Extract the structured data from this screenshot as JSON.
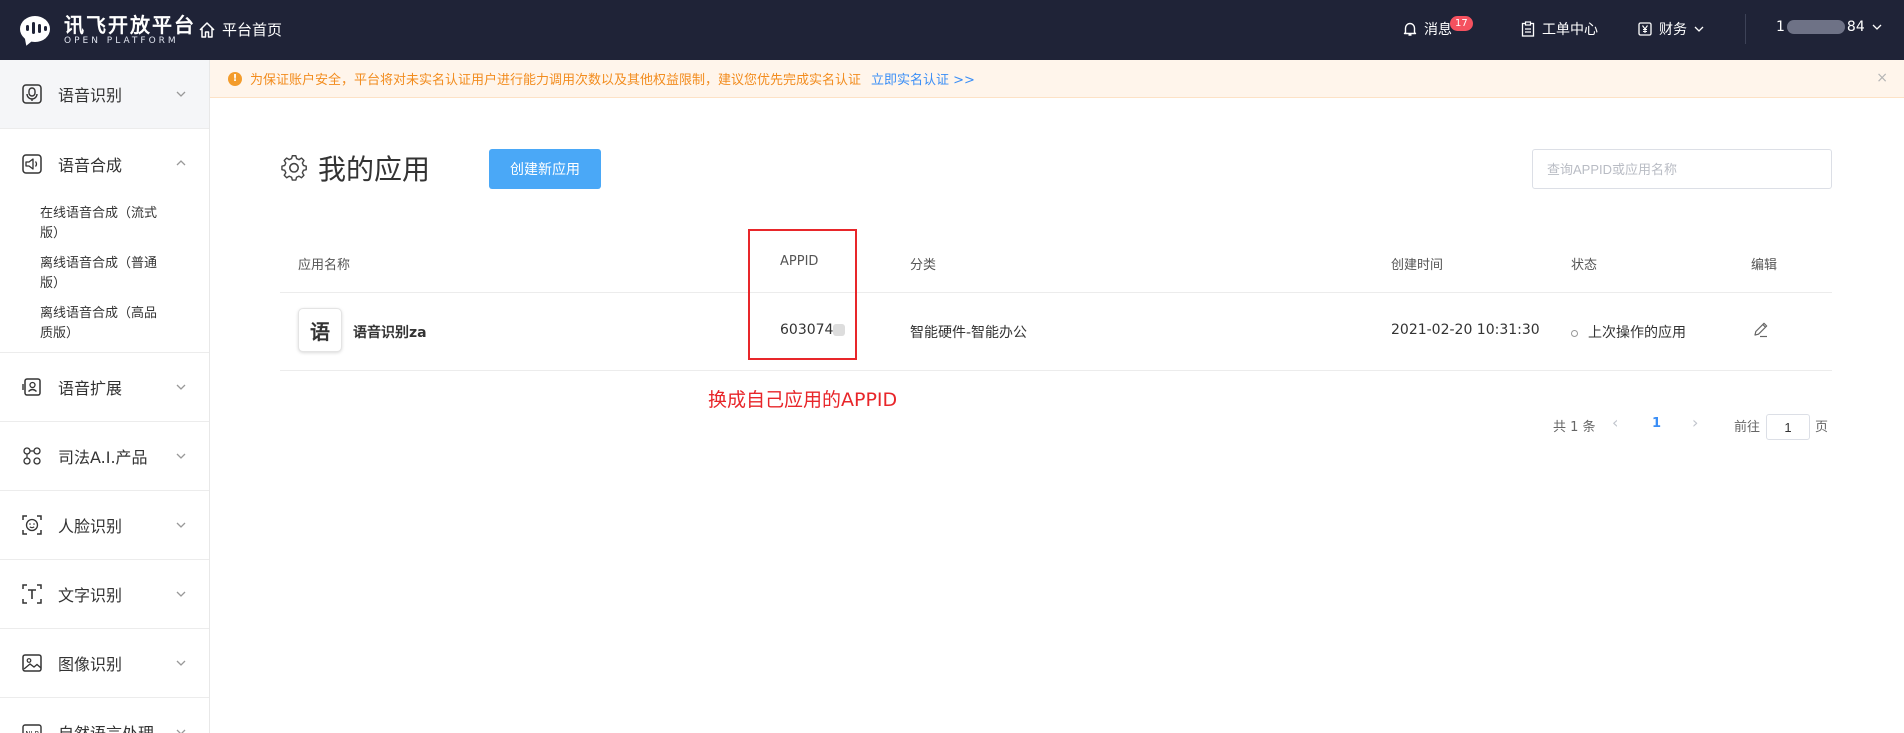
{
  "topbar": {
    "logo_cn": "讯飞开放平台",
    "logo_en": "OPEN PLATFORM",
    "home_label": "平台首页",
    "messages_label": "消息",
    "messages_count": "17",
    "ticket_label": "工单中心",
    "finance_label": "财务",
    "user_prefix": "1",
    "user_suffix": "84"
  },
  "sidebar": {
    "groups": [
      {
        "label": "语音识别",
        "icon": "microphone-icon",
        "expanded": false,
        "active": true
      },
      {
        "label": "语音合成",
        "icon": "speaker-icon",
        "expanded": true,
        "items": [
          "在线语音合成（流式版）",
          "离线语音合成（普通版）",
          "离线语音合成（高品质版）"
        ]
      },
      {
        "label": "语音扩展",
        "icon": "voice-ext-icon",
        "expanded": false
      },
      {
        "label": "司法A.I.产品",
        "icon": "scales-icon",
        "expanded": false
      },
      {
        "label": "人脸识别",
        "icon": "face-icon",
        "expanded": false
      },
      {
        "label": "文字识别",
        "icon": "text-ocr-icon",
        "expanded": false
      },
      {
        "label": "图像识别",
        "icon": "image-icon",
        "expanded": false
      },
      {
        "label": "自然语言处理",
        "icon": "nlp-icon",
        "expanded": false
      }
    ]
  },
  "notice": {
    "text": "为保证账户安全，平台将对未实名认证用户进行能力调用次数以及其他权益限制，建议您优先完成实名认证",
    "link": "立即实名认证 >>",
    "close": "×"
  },
  "main": {
    "title": "我的应用",
    "create_button": "创建新应用",
    "search_placeholder": "查询APPID或应用名称",
    "columns": [
      "应用名称",
      "APPID",
      "分类",
      "创建时间",
      "状态",
      "编辑"
    ],
    "rows": [
      {
        "icon_char": "语",
        "name": "语音识别za",
        "appid": "603074",
        "category": "智能硬件-智能办公",
        "created": "2021-02-20 10:31:30",
        "status": "上次操作的应用"
      }
    ],
    "annotation": "换成自己应用的APPID",
    "pagination": {
      "total": "共 1 条",
      "current_page": "1",
      "goto_label": "前往",
      "goto_value": "1",
      "page_suffix": "页"
    }
  },
  "colors": {
    "topbar_bg": "#1f2337",
    "primary": "#4aa8f7",
    "link": "#3a8ef6",
    "warning_text": "#f28c1e",
    "annotation_red": "#e8262a"
  }
}
